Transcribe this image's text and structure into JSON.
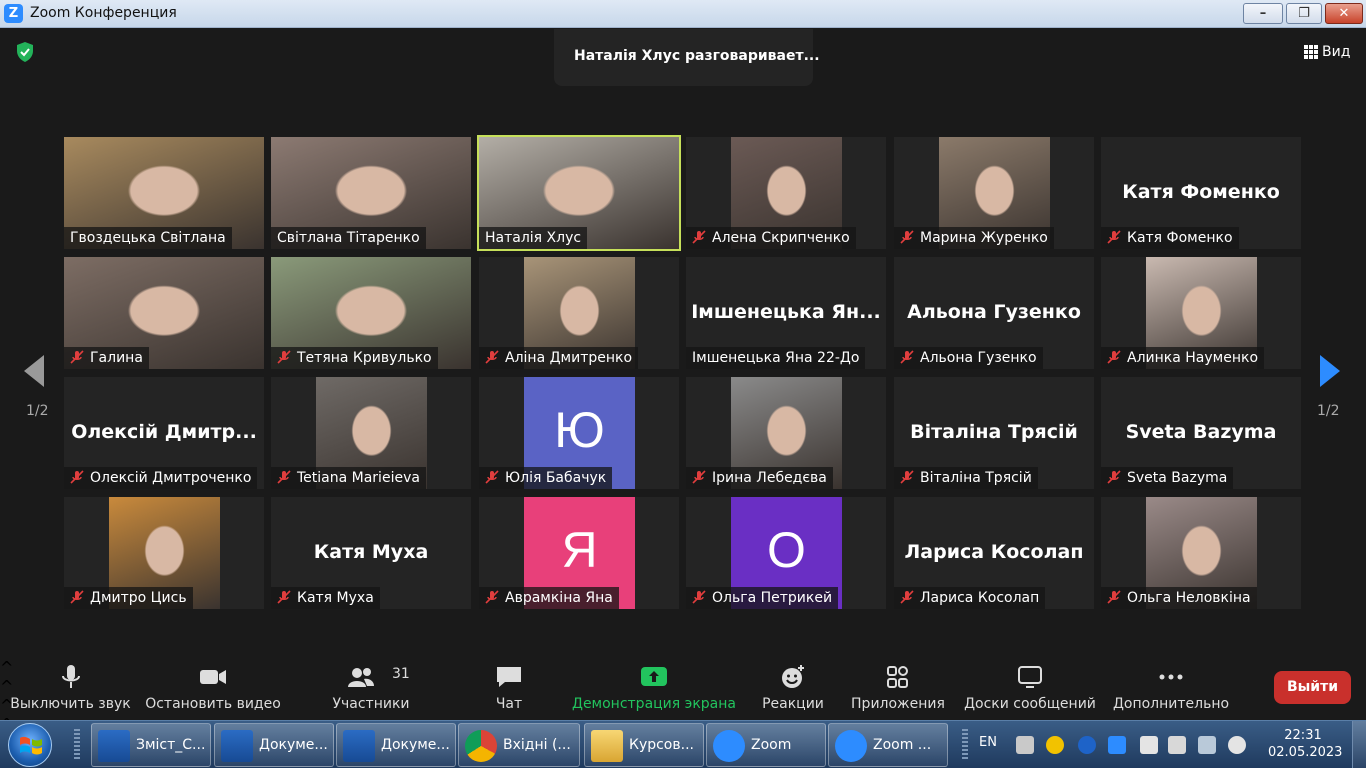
{
  "window": {
    "title": "Zoom Конференция",
    "app_icon_letter": "Z"
  },
  "meeting": {
    "speaking": "Наталія Хлус разговаривает...",
    "view_label": "Вид",
    "page_indicator": "1/2",
    "tiles": [
      {
        "name": "Гвоздецька Світлана",
        "muted": false,
        "video": "photo",
        "color": "#a88a5e"
      },
      {
        "name": "Світлана Тітаренко",
        "muted": false,
        "video": "photo",
        "color": "#8c7a72"
      },
      {
        "name": "Наталія Хлус",
        "muted": false,
        "video": "photo",
        "color": "#b3aea6",
        "active": true
      },
      {
        "name": "Алена Скрипченко",
        "muted": true,
        "video": "photo",
        "color": "#6b5a55"
      },
      {
        "name": "Марина Журенко",
        "muted": true,
        "video": "photo",
        "color": "#8b7a6a"
      },
      {
        "name": "Катя Фоменко",
        "muted": true,
        "video": "off",
        "bigname": "Катя Фоменко"
      },
      {
        "name": "Галина",
        "muted": true,
        "video": "photo",
        "color": "#7d6d64"
      },
      {
        "name": "Тетяна Кривулько",
        "muted": true,
        "video": "photo",
        "color": "#8a9a7a"
      },
      {
        "name": "Аліна Дмитренко",
        "muted": true,
        "video": "photo",
        "color": "#a89478"
      },
      {
        "name": "Імшенецька Яна 22-До",
        "muted": false,
        "video": "off",
        "bigname": "Імшенецька Ян..."
      },
      {
        "name": "Альона Гузенко",
        "muted": true,
        "video": "off",
        "bigname": "Альона Гузенко"
      },
      {
        "name": "Алинка Науменко",
        "muted": true,
        "video": "photo",
        "color": "#c9b9b0"
      },
      {
        "name": "Олексій Дмитроченко",
        "muted": true,
        "video": "off",
        "bigname": "Олексій Дмитр..."
      },
      {
        "name": "Tetiana Marieieva",
        "muted": true,
        "video": "photo",
        "color": "#6f6a66"
      },
      {
        "name": "Юлія Бабачук",
        "muted": true,
        "video": "avatar",
        "letter": "Ю",
        "color": "#5a63c5"
      },
      {
        "name": "Ірина Лебедєва",
        "muted": true,
        "video": "photo",
        "color": "#8a8a8a"
      },
      {
        "name": "Віталіна Трясій",
        "muted": true,
        "video": "off",
        "bigname": "Віталіна Трясій"
      },
      {
        "name": "Sveta Bazyma",
        "muted": true,
        "video": "off",
        "bigname": "Sveta Bazyma"
      },
      {
        "name": "Дмитро Цись",
        "muted": true,
        "video": "photo",
        "color": "#c98a3c"
      },
      {
        "name": "Катя Муха",
        "muted": true,
        "video": "off",
        "bigname": "Катя Муха"
      },
      {
        "name": "Аврамкіна Яна",
        "muted": true,
        "video": "avatar",
        "letter": "Я",
        "color": "#e8407a"
      },
      {
        "name": "Ольга Петрикей",
        "muted": true,
        "video": "avatar",
        "letter": "О",
        "color": "#6a2fc4"
      },
      {
        "name": "Лариса Косолап",
        "muted": true,
        "video": "off",
        "bigname": "Лариса Косолап"
      },
      {
        "name": "Ольга Неловкіна",
        "muted": true,
        "video": "photo",
        "color": "#9a8a88"
      }
    ]
  },
  "toolbar": {
    "mute": "Выключить звук",
    "video": "Остановить видео",
    "participants": "Участники",
    "participants_count": "31",
    "chat": "Чат",
    "share": "Демонстрация экрана",
    "reactions": "Реакции",
    "apps": "Приложения",
    "whiteboards": "Доски сообщений",
    "more": "Дополнительно",
    "leave": "Выйти",
    "share_color": "#22c45e"
  },
  "taskbar": {
    "buttons": [
      {
        "label": "Зміст_С...",
        "icon": "word-icon"
      },
      {
        "label": "Докуме...",
        "icon": "word-icon"
      },
      {
        "label": "Докуме...",
        "icon": "word-icon"
      },
      {
        "label": "Вхідні (...",
        "icon": "chrome-icon"
      },
      {
        "label": "Курсов...",
        "icon": "folder-icon"
      },
      {
        "label": "Zoom",
        "icon": "zoom-icon"
      },
      {
        "label": "Zoom ...",
        "icon": "zoom-icon"
      }
    ],
    "lang": "EN",
    "time": "22:31",
    "date": "02.05.2023"
  }
}
